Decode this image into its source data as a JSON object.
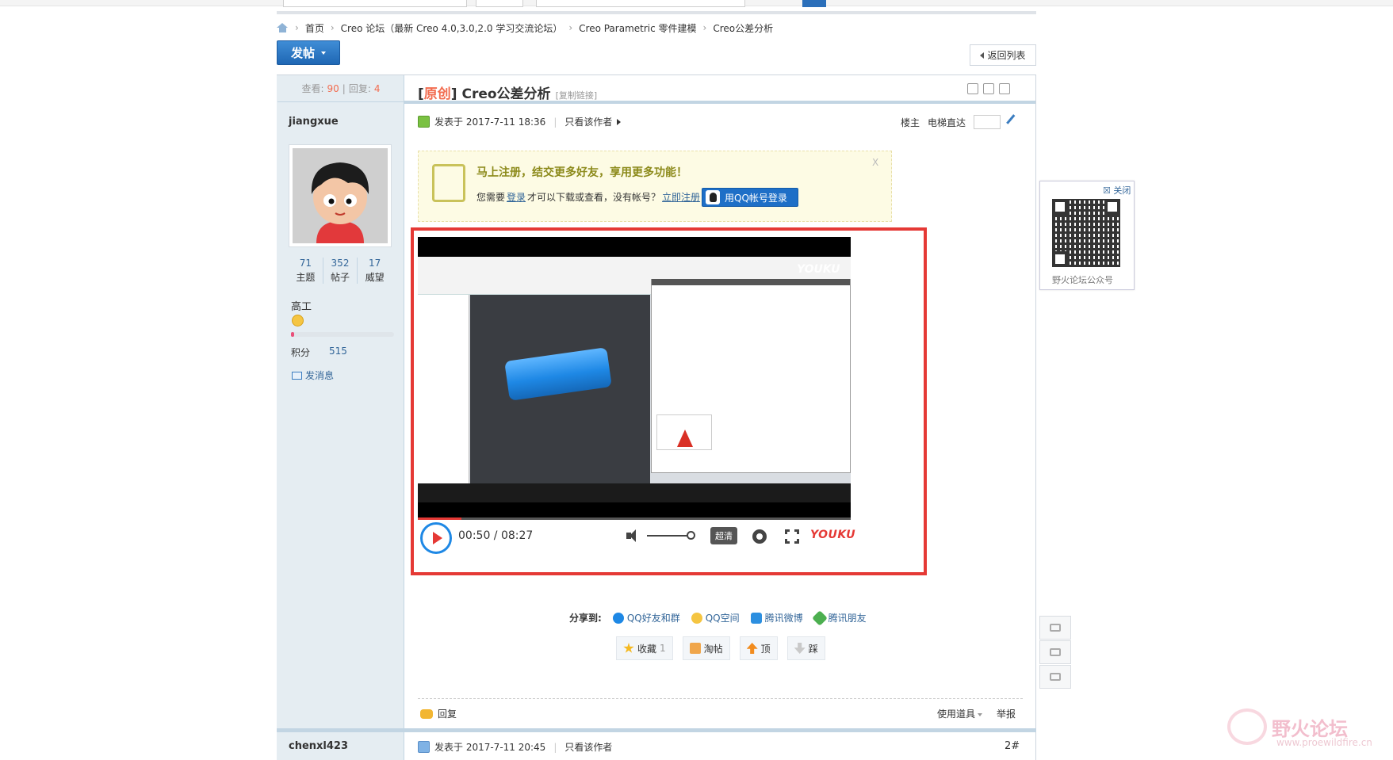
{
  "breadcrumb": {
    "items": [
      "首页",
      "Creo 论坛（最新 Creo 4.0,3.0,2.0 学习交流论坛）",
      "Creo Parametric 零件建模",
      "Creo公差分析"
    ]
  },
  "post_button": "发帖",
  "back_to_list": "返回列表",
  "thread": {
    "views_label": "查看:",
    "views": "90",
    "replies_label": "回复:",
    "replies": "4",
    "tag": "原创",
    "title": "Creo公差分析",
    "copy_link": "[复制链接]"
  },
  "first_post": {
    "author": "jiangxue",
    "stats": [
      {
        "value": "71",
        "label": "主题"
      },
      {
        "value": "352",
        "label": "帖子"
      },
      {
        "value": "17",
        "label": "威望"
      }
    ],
    "rank": "高工",
    "level_progress": 0.03,
    "points_label": "积分",
    "points": "515",
    "send_message": "发消息",
    "posted": "发表于 2017-7-11 18:36",
    "only_author": "只看该作者",
    "floor": "楼主",
    "elevator": "电梯直达"
  },
  "notice": {
    "title": "马上注册，结交更多好友，享用更多功能！",
    "body_prefix": "您需要",
    "login": "登录",
    "body_middle": "才可以下载或查看，没有帐号？",
    "register": "立即注册",
    "qq_login": "用QQ帐号登录",
    "close": "X"
  },
  "video": {
    "time": "00:50 / 08:27",
    "quality": "超清",
    "brand": "YOUKU",
    "watermark": "YOUKU",
    "progress": 0.1
  },
  "share": {
    "label": "分享到:",
    "items": [
      "QQ好友和群",
      "QQ空间",
      "腾讯微博",
      "腾讯朋友"
    ]
  },
  "actions": {
    "favorite": "收藏",
    "favorite_count": "1",
    "taotie": "淘帖",
    "up": "顶",
    "down": "踩"
  },
  "post_footer": {
    "reply": "回复",
    "tools": "使用道具",
    "report": "举报"
  },
  "second_post": {
    "author": "chenxl423",
    "posted": "发表于 2017-7-11 20:45",
    "only_author": "只看该作者",
    "floor": "2#"
  },
  "qr_widget": {
    "close": "关闭",
    "label": "野火论坛公众号"
  },
  "site_watermark": {
    "name": "野火论坛",
    "url": "www.proewildfire.cn"
  }
}
